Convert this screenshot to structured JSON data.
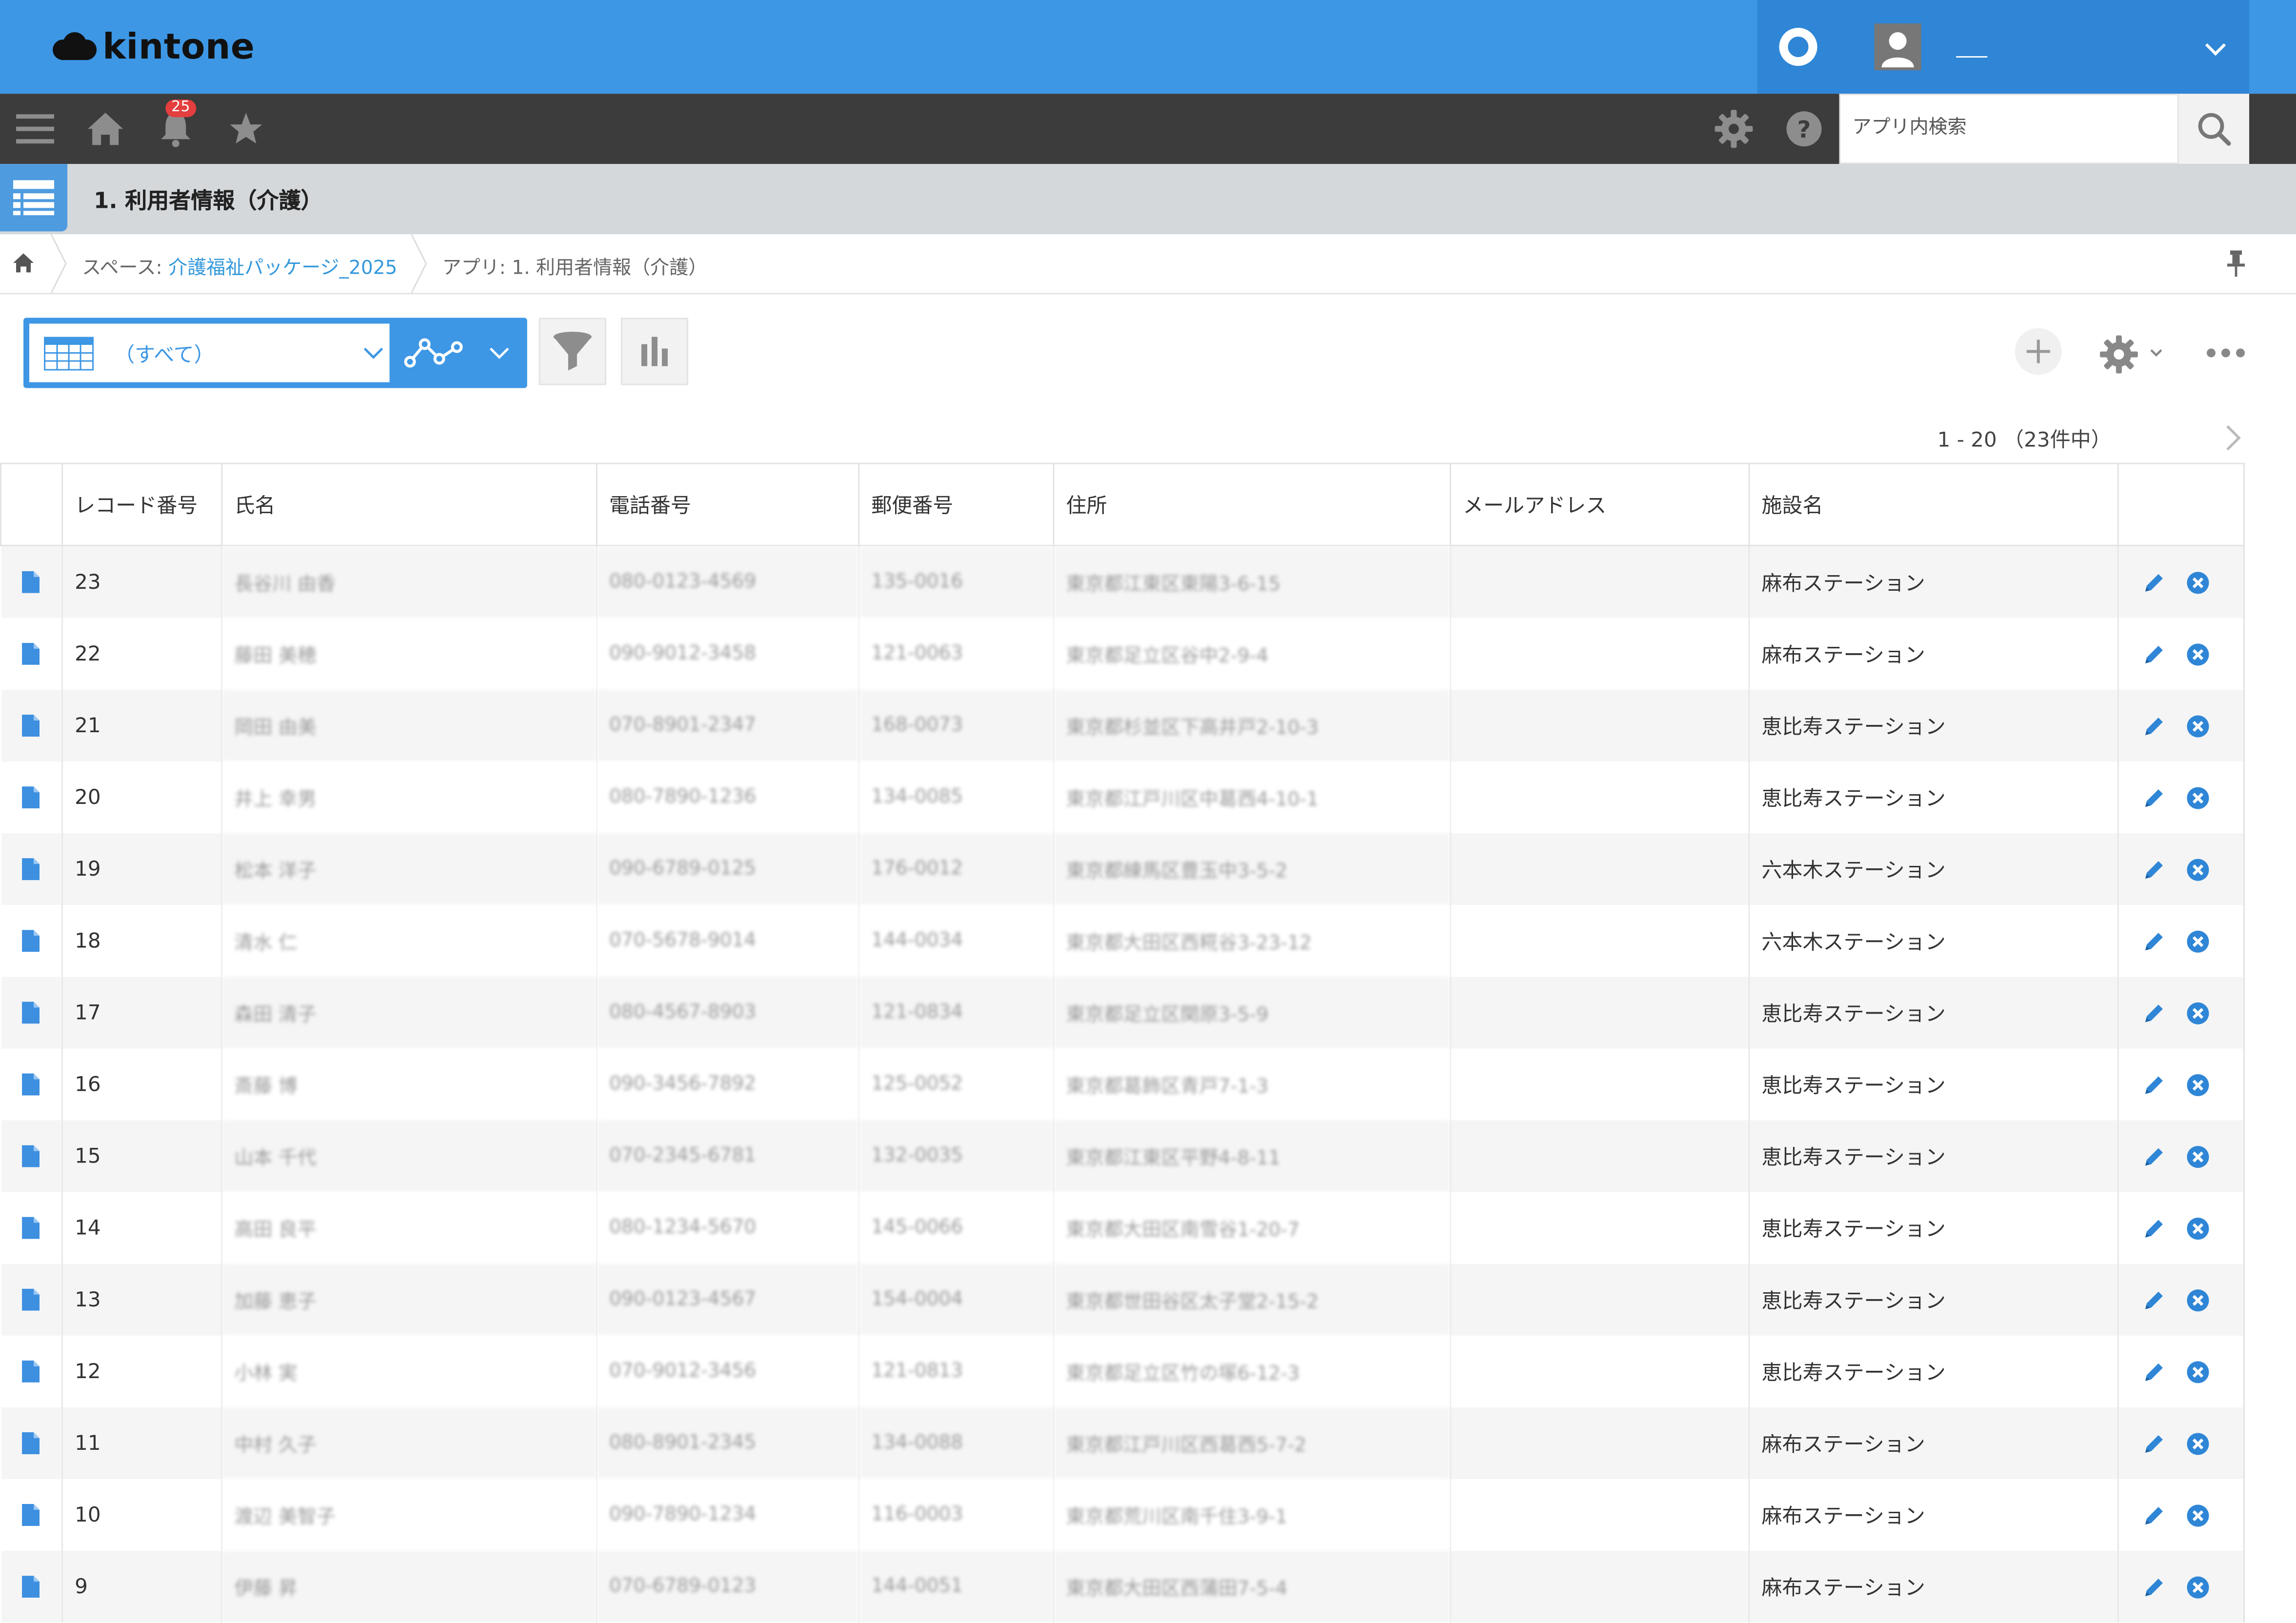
{
  "header": {
    "logo_text": "kintone",
    "user_name": "___"
  },
  "nav": {
    "notification_count": "25",
    "search_placeholder": "アプリ内検索"
  },
  "app": {
    "title": "1. 利用者情報（介護）"
  },
  "breadcrumb": {
    "space_prefix": "スペース: ",
    "space_name": "介護福祉パッケージ_2025",
    "app_crumb": "アプリ: 1. 利用者情報（介護）"
  },
  "toolbar": {
    "view_name": "（すべて）",
    "pager": "1 - 20 （23件中）"
  },
  "table": {
    "columns": [
      "レコード番号",
      "氏名",
      "電話番号",
      "郵便番号",
      "住所",
      "メールアドレス",
      "施設名"
    ],
    "rows": [
      {
        "id": "23",
        "name": "長谷川 由香",
        "phone": "080-0123-4569",
        "zip": "135-0016",
        "address": "東京都江東区東陽3-6-15",
        "email": "",
        "facility": "麻布ステーション"
      },
      {
        "id": "22",
        "name": "藤田 美穂",
        "phone": "090-9012-3458",
        "zip": "121-0063",
        "address": "東京都足立区谷中2-9-4",
        "email": "",
        "facility": "麻布ステーション"
      },
      {
        "id": "21",
        "name": "岡田 由美",
        "phone": "070-8901-2347",
        "zip": "168-0073",
        "address": "東京都杉並区下高井戸2-10-3",
        "email": "",
        "facility": "恵比寿ステーション"
      },
      {
        "id": "20",
        "name": "井上 幸男",
        "phone": "080-7890-1236",
        "zip": "134-0085",
        "address": "東京都江戸川区中葛西4-10-1",
        "email": "",
        "facility": "恵比寿ステーション"
      },
      {
        "id": "19",
        "name": "松本 洋子",
        "phone": "090-6789-0125",
        "zip": "176-0012",
        "address": "東京都練馬区豊玉中3-5-2",
        "email": "",
        "facility": "六本木ステーション"
      },
      {
        "id": "18",
        "name": "清水 仁",
        "phone": "070-5678-9014",
        "zip": "144-0034",
        "address": "東京都大田区西糀谷3-23-12",
        "email": "",
        "facility": "六本木ステーション"
      },
      {
        "id": "17",
        "name": "森田 清子",
        "phone": "080-4567-8903",
        "zip": "121-0834",
        "address": "東京都足立区関原3-5-9",
        "email": "",
        "facility": "恵比寿ステーション"
      },
      {
        "id": "16",
        "name": "斎藤 博",
        "phone": "090-3456-7892",
        "zip": "125-0052",
        "address": "東京都葛飾区青戸7-1-3",
        "email": "",
        "facility": "恵比寿ステーション"
      },
      {
        "id": "15",
        "name": "山本 千代",
        "phone": "070-2345-6781",
        "zip": "132-0035",
        "address": "東京都江東区平野4-8-11",
        "email": "",
        "facility": "恵比寿ステーション"
      },
      {
        "id": "14",
        "name": "高田 良平",
        "phone": "080-1234-5670",
        "zip": "145-0066",
        "address": "東京都大田区南雪谷1-20-7",
        "email": "",
        "facility": "恵比寿ステーション"
      },
      {
        "id": "13",
        "name": "加藤 恵子",
        "phone": "090-0123-4567",
        "zip": "154-0004",
        "address": "東京都世田谷区太子堂2-15-2",
        "email": "",
        "facility": "恵比寿ステーション"
      },
      {
        "id": "12",
        "name": "小林 実",
        "phone": "070-9012-3456",
        "zip": "121-0813",
        "address": "東京都足立区竹の塚6-12-3",
        "email": "",
        "facility": "恵比寿ステーション"
      },
      {
        "id": "11",
        "name": "中村 久子",
        "phone": "080-8901-2345",
        "zip": "134-0088",
        "address": "東京都江戸川区西葛西5-7-2",
        "email": "",
        "facility": "麻布ステーション"
      },
      {
        "id": "10",
        "name": "渡辺 美智子",
        "phone": "090-7890-1234",
        "zip": "116-0003",
        "address": "東京都荒川区南千住3-9-1",
        "email": "",
        "facility": "麻布ステーション"
      },
      {
        "id": "9",
        "name": "伊藤 昇",
        "phone": "070-6789-0123",
        "zip": "144-0051",
        "address": "東京都大田区西蒲田7-5-4",
        "email": "",
        "facility": "麻布ステーション"
      }
    ]
  },
  "colors": {
    "header_blue": "#3d97e5",
    "nav_dark": "#3c3c3c",
    "title_bar": "#d4d8db",
    "link_blue": "#3498db",
    "badge_red": "#e43e3e"
  },
  "icons": {
    "logo": "cloud-logo-icon",
    "ring": "notification-ring-icon",
    "menu": "hamburger-menu-icon",
    "home": "home-icon",
    "bell": "bell-icon",
    "star": "star-icon",
    "gear": "gear-icon",
    "help": "help-icon",
    "search": "search-icon",
    "view": "table-view-icon",
    "graph": "graph-icon",
    "filter": "filter-icon",
    "chart": "chart-icon",
    "add": "plus-icon",
    "more": "more-icon",
    "pin": "pin-icon",
    "record": "document-icon",
    "edit": "pencil-icon",
    "delete": "delete-icon"
  }
}
